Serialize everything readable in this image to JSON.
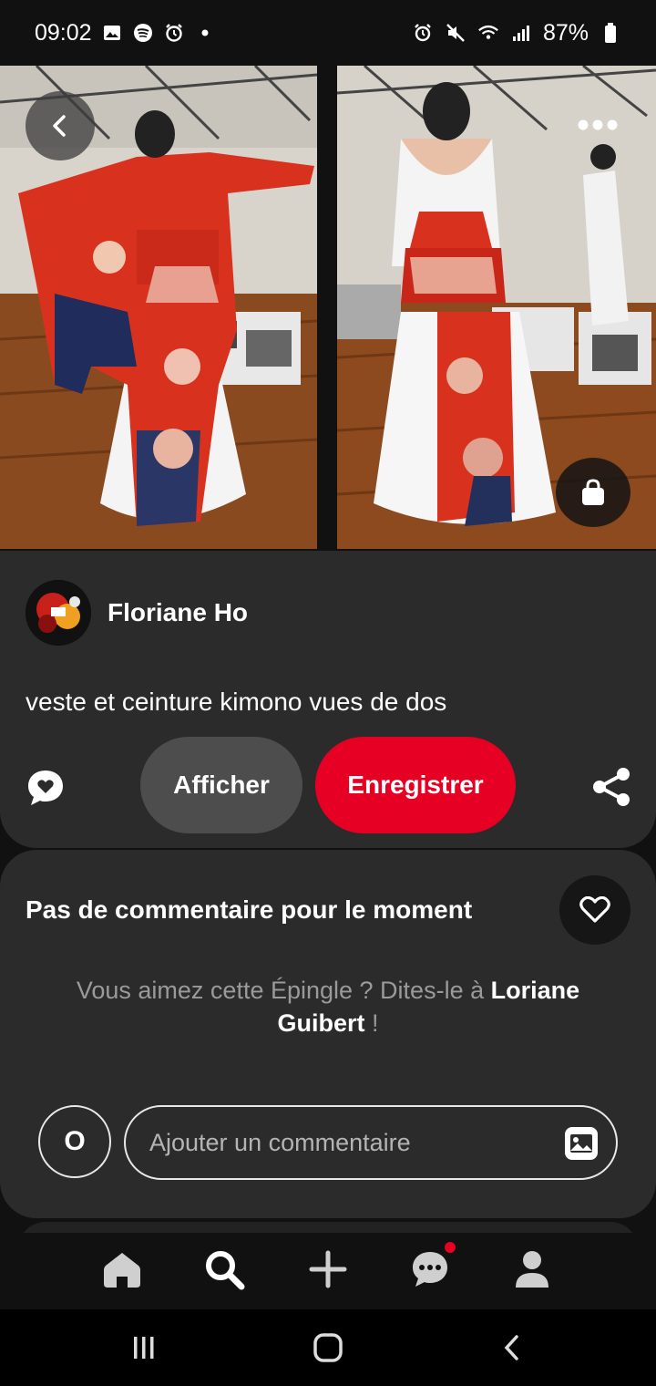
{
  "status_bar": {
    "time": "09:02",
    "battery": "87%"
  },
  "pin": {
    "author": "Floriane Ho",
    "description": "veste et ceinture kimono vues de dos",
    "view_label": "Afficher",
    "save_label": "Enregistrer"
  },
  "comments": {
    "title": "Pas de commentaire pour le moment",
    "prompt_prefix": "Vous aimez cette Épingle ? Dites-le à ",
    "prompt_name": "Loriane Guibert",
    "prompt_suffix": " !",
    "user_initial": "O",
    "input_placeholder": "Ajouter un commentaire"
  },
  "colors": {
    "accent": "#e60023",
    "card": "#2b2b2b",
    "background": "#111111"
  },
  "nav": {
    "items": [
      "home-icon",
      "search-icon",
      "plus-icon",
      "messages-icon",
      "profile-icon"
    ]
  }
}
